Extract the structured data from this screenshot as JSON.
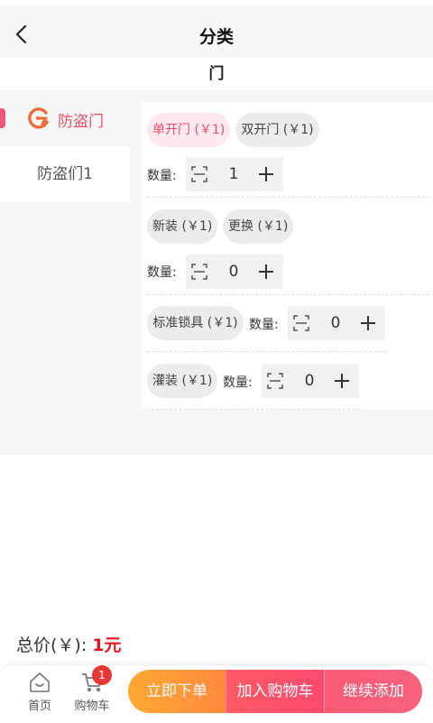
{
  "header": {
    "title": "分类"
  },
  "category_title": "门",
  "sidebar": {
    "active": {
      "label": "防盗门",
      "icon": "brand-logo-icon"
    },
    "items": [
      {
        "label": "防盗们1"
      }
    ]
  },
  "option_groups": [
    {
      "chips": [
        {
          "label": "单开门 (￥1)",
          "selected": true
        },
        {
          "label": "双开门 (￥1)",
          "selected": false
        }
      ],
      "qty_label": "数量:",
      "quantity": "1"
    },
    {
      "chips": [
        {
          "label": "新装 (￥1)",
          "selected": false
        },
        {
          "label": "更换 (￥1)",
          "selected": false
        }
      ],
      "qty_label": "数量:",
      "quantity": "0"
    },
    {
      "chips": [
        {
          "label": "标准锁具 (￥1)",
          "selected": false
        }
      ],
      "qty_label": "数量:",
      "quantity": "0"
    },
    {
      "chips": [
        {
          "label": "灌装 (￥1)",
          "selected": false
        }
      ],
      "qty_label": "数量:",
      "quantity": "0"
    }
  ],
  "total": {
    "label": "总价(￥):",
    "amount": "1元"
  },
  "bottom_nav": {
    "home": {
      "label": "首页",
      "icon": "home-icon"
    },
    "cart": {
      "label": "购物车",
      "icon": "cart-icon",
      "badge": "1"
    }
  },
  "actions": {
    "order_now": "立即下单",
    "add_to_cart": "加入购物车",
    "continue_add": "继续添加"
  },
  "colors": {
    "accent": "#e9506c",
    "price": "#e6141e",
    "order_button": "#ff9a38",
    "cart_button": "#fb4a6e"
  }
}
